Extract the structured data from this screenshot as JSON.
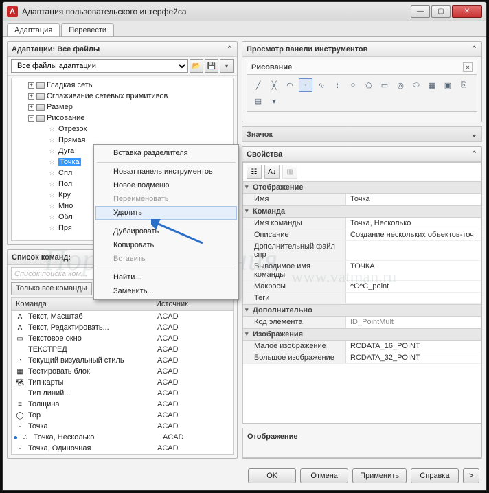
{
  "titlebar": {
    "title": "Адаптация пользовательского интерфейса"
  },
  "tabs": {
    "adapt": "Адаптация",
    "translate": "Перевести"
  },
  "left": {
    "adaptations_hd": "Адаптации: Все файлы",
    "combo": "Все файлы адаптации",
    "tree": {
      "n1": "Гладкая сеть",
      "n2": "Сглаживание сетевых примитивов",
      "n3": "Размер",
      "n4": "Рисование",
      "c1": "Отрезок",
      "c2": "Прямая",
      "c3": "Дуга",
      "c4": "Точка",
      "c5": "Спл",
      "c6": "Пол",
      "c7": "Кру",
      "c8": "Мно",
      "c9": "Обл",
      "c10": "Пря"
    },
    "cmdlist_hd": "Список команд:",
    "cmd_search_ph": "Список поиска ком...",
    "cmd_filter_btn": "Только все команды",
    "col_cmd": "Команда",
    "col_src": "Источник",
    "rows": [
      {
        "n": "Текст, Масштаб",
        "s": "ACAD"
      },
      {
        "n": "Текст, Редактировать...",
        "s": "ACAD"
      },
      {
        "n": "Текстовое окно",
        "s": "ACAD"
      },
      {
        "n": "ТЕКСТРЕД",
        "s": "ACAD"
      },
      {
        "n": "Текущий визуальный стиль",
        "s": "ACAD"
      },
      {
        "n": "Тестировать блок",
        "s": "ACAD"
      },
      {
        "n": "Тип карты",
        "s": "ACAD"
      },
      {
        "n": "Тип линий...",
        "s": "ACAD"
      },
      {
        "n": "Толщина",
        "s": "ACAD"
      },
      {
        "n": "Тор",
        "s": "ACAD"
      },
      {
        "n": "Точка",
        "s": "ACAD"
      },
      {
        "n": "Точка, Несколько",
        "s": "ACAD"
      },
      {
        "n": "Точка, Одиночная",
        "s": "ACAD"
      }
    ]
  },
  "ctx": {
    "m1": "Вставка разделителя",
    "m2": "Новая панель инструментов",
    "m3": "Новое подменю",
    "m4": "Переименовать",
    "m5": "Удалить",
    "m6": "Дублировать",
    "m7": "Копировать",
    "m8": "Вставить",
    "m9": "Найти...",
    "m10": "Заменить..."
  },
  "right": {
    "preview_hd": "Просмотр панели инструментов",
    "preview_name": "Рисование",
    "icon_hd": "Значок",
    "props_hd": "Свойства",
    "groups": {
      "g1": "Отображение",
      "g2": "Команда",
      "g3": "Дополнительно",
      "g4": "Изображения"
    },
    "rows": {
      "name_k": "Имя",
      "name_v": "Точка",
      "cmdname_k": "Имя команды",
      "cmdname_v": "Точка, Несколько",
      "desc_k": "Описание",
      "desc_v": "Создание нескольких объектов-точ",
      "extfile_k": "Дополнительный файл спр",
      "extfile_v": "",
      "dispcmd_k": "Выводимое имя команды",
      "dispcmd_v": "ТОЧКА",
      "macro_k": "Макросы",
      "macro_v": "^C^C_point",
      "tags_k": "Теги",
      "tags_v": "",
      "elid_k": "Код элемента",
      "elid_v": "ID_PointMult",
      "small_k": "Малое изображение",
      "small_v": "RCDATA_16_POINT",
      "big_k": "Большое изображение",
      "big_v": "RCDATA_32_POINT"
    },
    "desc_title": "Отображение"
  },
  "buttons": {
    "ok": "OK",
    "cancel": "Отмена",
    "apply": "Применить",
    "help": "Справка"
  },
  "wm1": "Портал черчения",
  "wm2": "www.vatman.ru"
}
